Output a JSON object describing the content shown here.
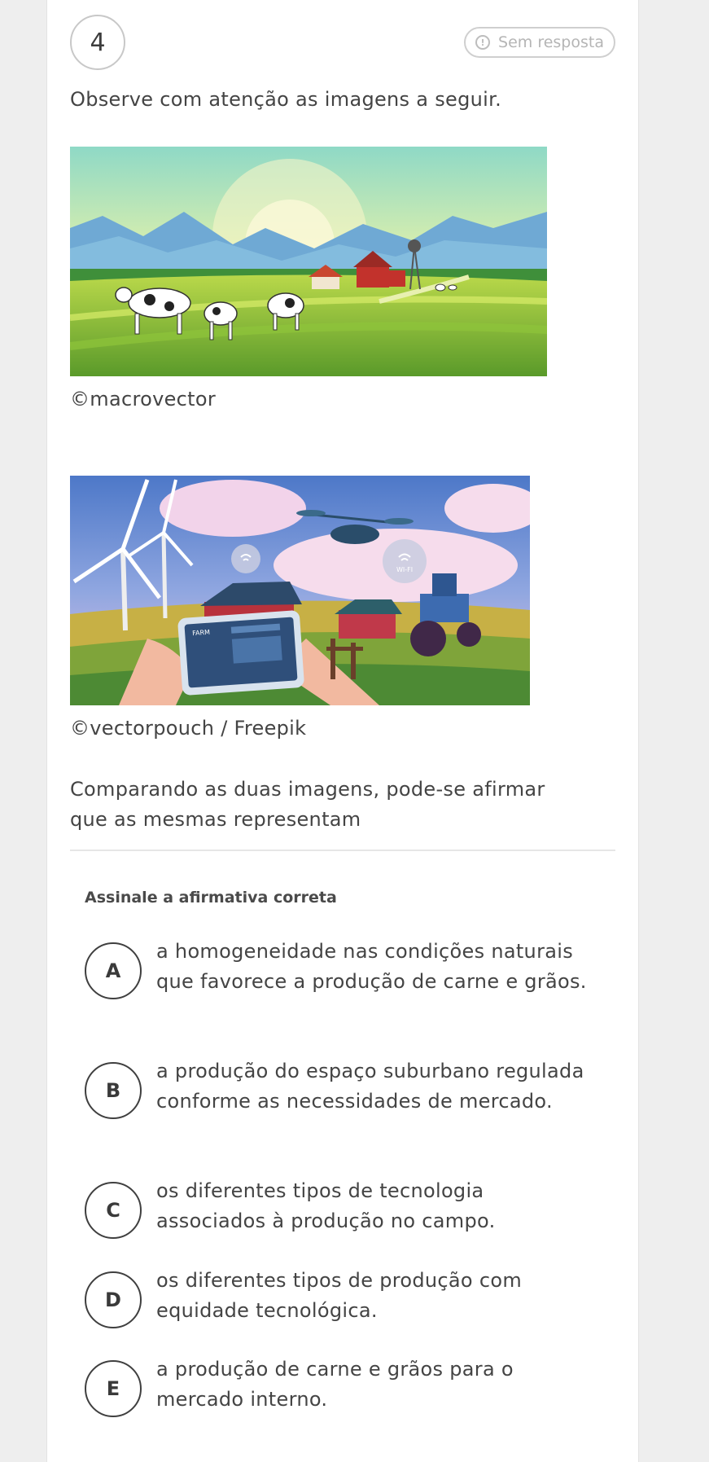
{
  "question": {
    "number": "4",
    "status_label": "Sem resposta",
    "status_icon": "exclamation-circle-icon",
    "intro": "Observe com atenção as imagens a seguir.",
    "image1_credit": "©macrovector",
    "image2_credit": "©vectorpouch / Freepik",
    "image2_sign_farm": "FARM",
    "image2_sign_wifi": "WI-FI",
    "prompt_line1": "Comparando as duas imagens, pode-se afirmar",
    "prompt_line2": "que as mesmas representam",
    "instruction": "Assinale a afirmativa correta"
  },
  "options": [
    {
      "letter": "A",
      "text": "a homogeneidade nas condições naturais que favorece a produção de carne e grãos."
    },
    {
      "letter": "B",
      "text": "a produção do espaço suburbano regulada conforme as necessidades de mercado."
    },
    {
      "letter": "C",
      "text": "os diferentes tipos de tecnologia associados à produção no campo."
    },
    {
      "letter": "D",
      "text": "os diferentes tipos de produção com equidade tecnológica."
    },
    {
      "letter": "E",
      "text": "a produção de carne e grãos para o mercado interno."
    }
  ],
  "colors": {
    "background": "#eeeeee",
    "card": "#ffffff",
    "text": "#444444",
    "muted": "#b5b5b5"
  }
}
